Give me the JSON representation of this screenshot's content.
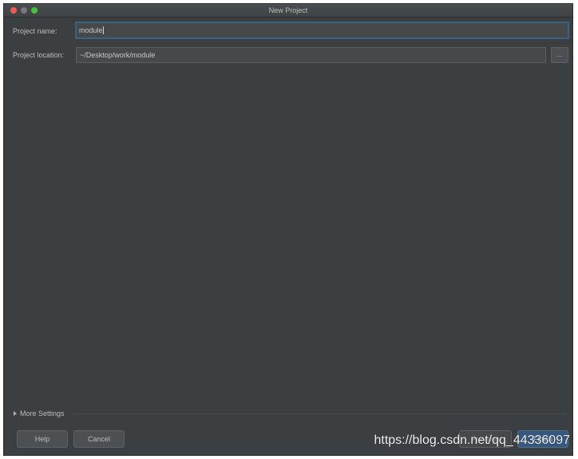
{
  "window": {
    "title": "New Project"
  },
  "form": {
    "project_name_label": "Project name:",
    "project_name_value": "module",
    "project_location_label": "Project location:",
    "project_location_value": "~/Desktop/work/module",
    "browse_label": "..."
  },
  "settings": {
    "more_settings_label": "More Settings"
  },
  "footer": {
    "help_label": "Help",
    "cancel_label": "Cancel",
    "previous_label": "Previous",
    "finish_label": "Finish"
  },
  "watermark": {
    "text": "https://blog.csdn.net/qq_44336097"
  },
  "colors": {
    "window_bg": "#3c3f41",
    "field_bg": "#45494a",
    "focus_border": "#3d6185",
    "primary_button": "#365880",
    "close_dot": "#ee5b55",
    "maximize_dot": "#45c03b"
  }
}
